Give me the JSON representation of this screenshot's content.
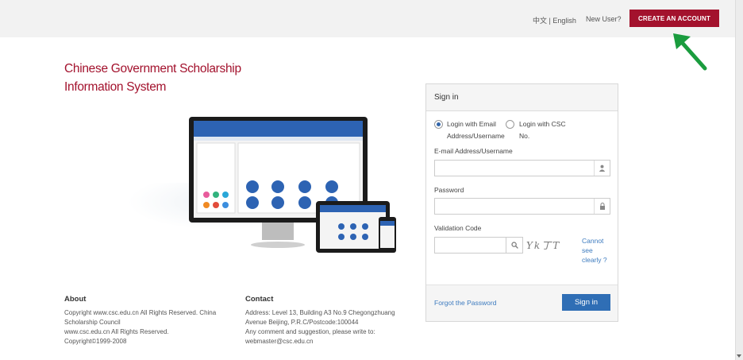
{
  "header": {
    "lang_chinese": "中文",
    "lang_sep": "|",
    "lang_english": "English",
    "new_user": "New User?",
    "create_account": "CREATE AN ACCOUNT"
  },
  "site_title_line1": "Chinese Government Scholarship",
  "site_title_line2": "Information System",
  "signin": {
    "heading": "Sign in",
    "option_email_line1": "Login with Email",
    "option_email_line2": "Address/Username",
    "option_csc_line1": "Login with CSC",
    "option_csc_line2": "No.",
    "email_label": "E-mail Address/Username",
    "password_label": "Password",
    "validation_label": "Validation Code",
    "captcha_text": "Yk丁T",
    "cannot_see": "Cannot see clearly ?",
    "forgot": "Forgot the Password",
    "submit": "Sign in"
  },
  "footer": {
    "about_heading": "About",
    "about_text": "Copyright www.csc.edu.cn All Rights Reserved. China Scholarship Council\nwww.csc.edu.cn All Rights Reserved.\nCopyright©1999-2008",
    "contact_heading": "Contact",
    "contact_text": "Address: Level 13, Building A3 No.9 Chegongzhuang Avenue Beijing, P.R.C/Postcode:100044\nAny comment and suggestion, please write to:\nwebmaster@csc.edu.cn"
  },
  "colors": {
    "brand_red": "#a3122d",
    "link_blue": "#3d7bbf",
    "button_blue": "#2f6eb5",
    "arrow_green": "#1a9c3e"
  },
  "icons": {
    "user": "user-icon",
    "lock": "lock-icon",
    "search": "search-icon",
    "arrow": "green-arrow-icon"
  }
}
